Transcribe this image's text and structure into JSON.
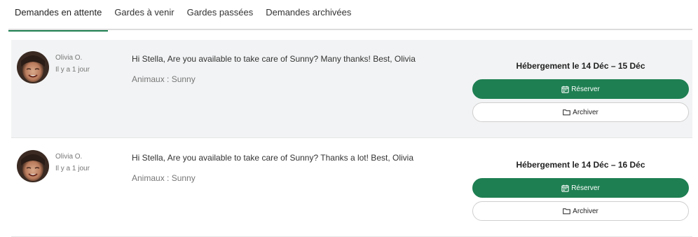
{
  "tabs": [
    {
      "label": "Demandes en attente",
      "active": true
    },
    {
      "label": "Gardes à venir",
      "active": false
    },
    {
      "label": "Gardes passées",
      "active": false
    },
    {
      "label": "Demandes archivées",
      "active": false
    }
  ],
  "colors": {
    "accent": "#1e7f52",
    "highlight_row": "#f2f3f4",
    "muted_text": "#777777"
  },
  "requests": [
    {
      "sender_name": "Olivia O.",
      "time_ago": "Il y a 1 jour",
      "message": "Hi Stella, Are you available to take care of Sunny? Many thanks! Best, Olivia",
      "pets": "Animaux : Sunny",
      "stay": "Hébergement le 14 Déc – 15 Déc",
      "reserve_label": "Réserver",
      "archive_label": "Archiver",
      "reserve_icon": "calendar-icon",
      "archive_icon": "folder-icon"
    },
    {
      "sender_name": "Olivia O.",
      "time_ago": "Il y a 1 jour",
      "message": "Hi Stella, Are you available to take care of Sunny? Thanks a lot! Best, Olivia",
      "pets": "Animaux : Sunny",
      "stay": "Hébergement le 14 Déc – 16 Déc",
      "reserve_label": "Réserver",
      "archive_label": "Archiver",
      "reserve_icon": "calendar-icon",
      "archive_icon": "folder-icon"
    }
  ]
}
